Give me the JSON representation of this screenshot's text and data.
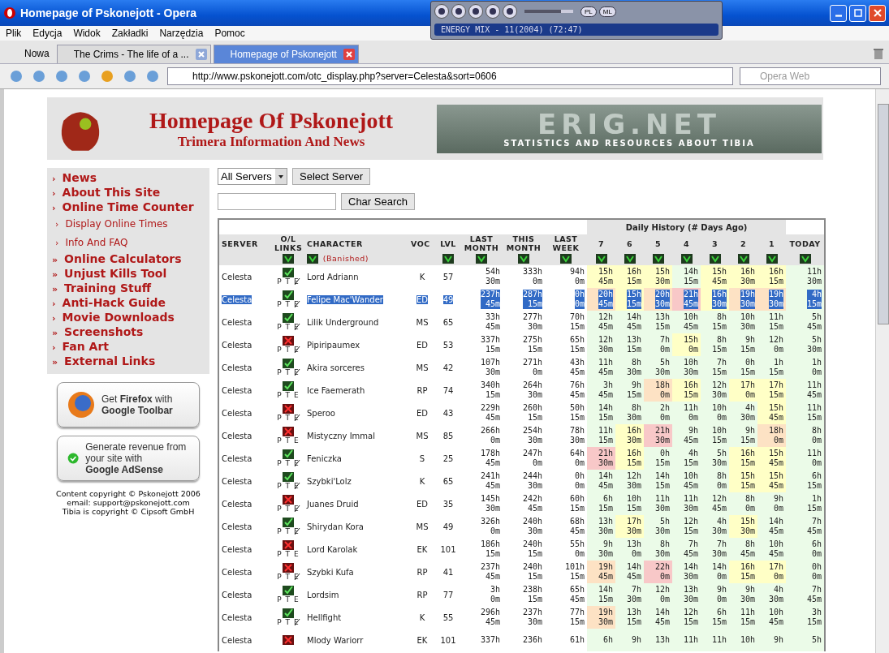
{
  "window": {
    "title": "Homepage of Pskonejott - Opera"
  },
  "player": {
    "track": "ENERGY MIX - 11(2004) (72:47)",
    "buttons": [
      "PL",
      "ML"
    ],
    "level": 0.75
  },
  "menu": [
    "Plik",
    "Edycja",
    "Widok",
    "Zakładki",
    "Narzędzia",
    "Pomoc"
  ],
  "new_tab": "Nowa",
  "tabs": [
    {
      "label": "The Crims - The life of a ...",
      "selected": false
    },
    {
      "label": "Homepage of Pskonejott",
      "selected": true
    }
  ],
  "address": "http://www.pskonejott.com/otc_display.php?server=Celesta&sort=0606",
  "search": {
    "placeholder": "Opera Web"
  },
  "header": {
    "title": "Homepage Of Pskonejott",
    "subtitle": "Trimera Information And News",
    "banner_logo": "ERIG.NET",
    "banner_caption": "STATISTICS AND RESOURCES ABOUT TIBIA"
  },
  "sidebar": [
    {
      "marker": "›",
      "label": "News",
      "kind": "main"
    },
    {
      "marker": "›",
      "label": "About This Site",
      "kind": "main"
    },
    {
      "marker": "›",
      "label": "Online Time Counter",
      "kind": "main"
    },
    {
      "marker": "›",
      "label": "Display Online Times",
      "kind": "sub"
    },
    {
      "marker": "›",
      "label": "Info And FAQ",
      "kind": "sub"
    },
    {
      "marker": "»",
      "label": "Online Calculators",
      "kind": "main"
    },
    {
      "marker": "»",
      "label": "Unjust Kills Tool",
      "kind": "main"
    },
    {
      "marker": "»",
      "label": "Training Stuff",
      "kind": "main"
    },
    {
      "marker": "›",
      "label": "Anti-Hack Guide",
      "kind": "main"
    },
    {
      "marker": "›",
      "label": "Movie Downloads",
      "kind": "main"
    },
    {
      "marker": "»",
      "label": "Screenshots",
      "kind": "main"
    },
    {
      "marker": "›",
      "label": "Fan Art",
      "kind": "main"
    },
    {
      "marker": "»",
      "label": "External Links",
      "kind": "main"
    }
  ],
  "ads": [
    {
      "kind": "firefox",
      "text": "Get **Firefox** with",
      "brand": "Google Toolbar"
    },
    {
      "kind": "adsense",
      "text": "Generate revenue from your site with",
      "brand": "**Google** AdSense"
    }
  ],
  "copyright": [
    "Content copyright © Pskonejott 2006",
    "email: support@pskonejott.com",
    "Tibia is copyright © Cipsoft GmbH"
  ],
  "server_select": {
    "value": "All Servers",
    "button": "Select Server"
  },
  "char_search": {
    "button": "Char Search"
  },
  "table": {
    "group_heading": "Daily History (# Days Ago)",
    "banished_label": "(Banished)",
    "columns": [
      {
        "label": "SERVER",
        "sortable": false
      },
      {
        "label": "O/L LINKS",
        "sortable": true
      },
      {
        "label": "CHARACTER",
        "sortable": true
      },
      {
        "label": "VOC",
        "sortable": false
      },
      {
        "label": "LVL",
        "sortable": true
      },
      {
        "label": "LAST MONTH",
        "sortable": true
      },
      {
        "label": "THIS MONTH",
        "sortable": true
      },
      {
        "label": "LAST WEEK",
        "sortable": true
      },
      {
        "label": "7",
        "sortable": true
      },
      {
        "label": "6",
        "sortable": true
      },
      {
        "label": "5",
        "sortable": true
      },
      {
        "label": "4",
        "sortable": true
      },
      {
        "label": "3",
        "sortable": true
      },
      {
        "label": "2",
        "sortable": true
      },
      {
        "label": "1",
        "sortable": true
      },
      {
        "label": "TODAY",
        "sortable": true
      }
    ],
    "rows": [
      {
        "server": "Celesta",
        "online": true,
        "links": "P T E",
        "e_crossed": true,
        "character": "Lord Adriann",
        "voc": "K",
        "lvl": "57",
        "selected": false,
        "totals": [
          {
            "h": "54h",
            "m": "30m"
          },
          {
            "h": "333h",
            "m": "0m"
          },
          {
            "h": "94h",
            "m": "0m"
          }
        ],
        "history": [
          {
            "h": "15h",
            "m": "45m",
            "color": "#ffffc6"
          },
          {
            "h": "16h",
            "m": "15m",
            "color": "#ffffc6"
          },
          {
            "h": "15h",
            "m": "30m",
            "color": "#ffffc6"
          },
          {
            "h": "14h",
            "m": "15m",
            "color": "#ebfbe8"
          },
          {
            "h": "15h",
            "m": "45m",
            "color": "#ffffc6"
          },
          {
            "h": "16h",
            "m": "30m",
            "color": "#ffffc6"
          },
          {
            "h": "16h",
            "m": "15m",
            "color": "#ffffc6"
          }
        ],
        "today": {
          "h": "11h",
          "m": "30m"
        }
      },
      {
        "server": "Celesta",
        "online": true,
        "links": "P T E",
        "e_crossed": true,
        "character": "Felipe Mac'Wander",
        "voc": "ED",
        "lvl": "49",
        "selected": true,
        "totals": [
          {
            "h": "237h",
            "m": "45m"
          },
          {
            "h": "287h",
            "m": "15m"
          },
          {
            "h": "0h",
            "m": "0m"
          }
        ],
        "history": [
          {
            "h": "20h",
            "m": "45m",
            "color": "#fde2c4"
          },
          {
            "h": "15h",
            "m": "15m",
            "color": "#ffffc6"
          },
          {
            "h": "20h",
            "m": "30m",
            "color": "#fde2c4"
          },
          {
            "h": "21h",
            "m": "45m",
            "color": "#f8c8c8"
          },
          {
            "h": "16h",
            "m": "30m",
            "color": "#ffffc6"
          },
          {
            "h": "19h",
            "m": "30m",
            "color": "#fde2c4"
          },
          {
            "h": "19h",
            "m": "30m",
            "color": "#fde2c4"
          }
        ],
        "today": {
          "h": "4h",
          "m": "15m"
        }
      },
      {
        "server": "Celesta",
        "online": true,
        "links": "P T E",
        "e_crossed": true,
        "character": "Lilik Underground",
        "voc": "MS",
        "lvl": "65",
        "selected": false,
        "totals": [
          {
            "h": "33h",
            "m": "45m"
          },
          {
            "h": "277h",
            "m": "30m"
          },
          {
            "h": "70h",
            "m": "15m"
          }
        ],
        "history": [
          {
            "h": "12h",
            "m": "45m",
            "color": "#ebfbe8"
          },
          {
            "h": "14h",
            "m": "45m",
            "color": "#ebfbe8"
          },
          {
            "h": "13h",
            "m": "15m",
            "color": "#ebfbe8"
          },
          {
            "h": "10h",
            "m": "45m",
            "color": "#ebfbe8"
          },
          {
            "h": "8h",
            "m": "15m",
            "color": "#ebfbe8"
          },
          {
            "h": "10h",
            "m": "30m",
            "color": "#ebfbe8"
          },
          {
            "h": "11h",
            "m": "15m",
            "color": "#ebfbe8"
          }
        ],
        "today": {
          "h": "5h",
          "m": "45m"
        }
      },
      {
        "server": "Celesta",
        "online": false,
        "links": "P T E",
        "e_crossed": true,
        "character": "Pipiripaumex",
        "voc": "ED",
        "lvl": "53",
        "selected": false,
        "totals": [
          {
            "h": "337h",
            "m": "15m"
          },
          {
            "h": "275h",
            "m": "15m"
          },
          {
            "h": "65h",
            "m": "15m"
          }
        ],
        "history": [
          {
            "h": "12h",
            "m": "30m",
            "color": "#ebfbe8"
          },
          {
            "h": "13h",
            "m": "15m",
            "color": "#ebfbe8"
          },
          {
            "h": "7h",
            "m": "0m",
            "color": "#ebfbe8"
          },
          {
            "h": "15h",
            "m": "0m",
            "color": "#ffffc6"
          },
          {
            "h": "8h",
            "m": "15m",
            "color": "#ebfbe8"
          },
          {
            "h": "9h",
            "m": "15m",
            "color": "#ebfbe8"
          },
          {
            "h": "12h",
            "m": "0m",
            "color": "#ebfbe8"
          }
        ],
        "today": {
          "h": "5h",
          "m": "30m"
        }
      },
      {
        "server": "Celesta",
        "online": true,
        "links": "P T E",
        "e_crossed": true,
        "character": "Akira sorceres",
        "voc": "MS",
        "lvl": "42",
        "selected": false,
        "totals": [
          {
            "h": "107h",
            "m": "30m"
          },
          {
            "h": "271h",
            "m": "0m"
          },
          {
            "h": "43h",
            "m": "45m"
          }
        ],
        "history": [
          {
            "h": "11h",
            "m": "45m",
            "color": "#ebfbe8"
          },
          {
            "h": "8h",
            "m": "30m",
            "color": "#ebfbe8"
          },
          {
            "h": "5h",
            "m": "30m",
            "color": "#ebfbe8"
          },
          {
            "h": "10h",
            "m": "30m",
            "color": "#ebfbe8"
          },
          {
            "h": "7h",
            "m": "15m",
            "color": "#ebfbe8"
          },
          {
            "h": "0h",
            "m": "15m",
            "color": "#ebfbe8"
          },
          {
            "h": "1h",
            "m": "15m",
            "color": "#ebfbe8"
          }
        ],
        "today": {
          "h": "1h",
          "m": "0m"
        }
      },
      {
        "server": "Celesta",
        "online": true,
        "links": "P T E",
        "e_crossed": false,
        "character": "Ice Faemerath",
        "voc": "RP",
        "lvl": "74",
        "selected": false,
        "totals": [
          {
            "h": "340h",
            "m": "15m"
          },
          {
            "h": "264h",
            "m": "30m"
          },
          {
            "h": "76h",
            "m": "45m"
          }
        ],
        "history": [
          {
            "h": "3h",
            "m": "45m",
            "color": "#ebfbe8"
          },
          {
            "h": "9h",
            "m": "15m",
            "color": "#ebfbe8"
          },
          {
            "h": "18h",
            "m": "0m",
            "color": "#fde2c4"
          },
          {
            "h": "16h",
            "m": "15m",
            "color": "#ffffc6"
          },
          {
            "h": "12h",
            "m": "30m",
            "color": "#ebfbe8"
          },
          {
            "h": "17h",
            "m": "0m",
            "color": "#ffffc6"
          },
          {
            "h": "17h",
            "m": "15m",
            "color": "#ffffc6"
          }
        ],
        "today": {
          "h": "11h",
          "m": "45m"
        }
      },
      {
        "server": "Celesta",
        "online": false,
        "links": "P T E",
        "e_crossed": true,
        "character": "Speroo",
        "voc": "ED",
        "lvl": "43",
        "selected": false,
        "totals": [
          {
            "h": "229h",
            "m": "45m"
          },
          {
            "h": "260h",
            "m": "15m"
          },
          {
            "h": "50h",
            "m": "15m"
          }
        ],
        "history": [
          {
            "h": "14h",
            "m": "15m",
            "color": "#ebfbe8"
          },
          {
            "h": "8h",
            "m": "30m",
            "color": "#ebfbe8"
          },
          {
            "h": "2h",
            "m": "0m",
            "color": "#ebfbe8"
          },
          {
            "h": "11h",
            "m": "0m",
            "color": "#ebfbe8"
          },
          {
            "h": "10h",
            "m": "0m",
            "color": "#ebfbe8"
          },
          {
            "h": "4h",
            "m": "30m",
            "color": "#ebfbe8"
          },
          {
            "h": "15h",
            "m": "45m",
            "color": "#ffffc6"
          }
        ],
        "today": {
          "h": "11h",
          "m": "15m"
        }
      },
      {
        "server": "Celesta",
        "online": false,
        "links": "P T E",
        "e_crossed": false,
        "character": "Mistyczny Immal",
        "voc": "MS",
        "lvl": "85",
        "selected": false,
        "totals": [
          {
            "h": "266h",
            "m": "0m"
          },
          {
            "h": "254h",
            "m": "30m"
          },
          {
            "h": "78h",
            "m": "30m"
          }
        ],
        "history": [
          {
            "h": "11h",
            "m": "15m",
            "color": "#ebfbe8"
          },
          {
            "h": "16h",
            "m": "30m",
            "color": "#ffffc6"
          },
          {
            "h": "21h",
            "m": "30m",
            "color": "#f8c8c8"
          },
          {
            "h": "9h",
            "m": "45m",
            "color": "#ebfbe8"
          },
          {
            "h": "10h",
            "m": "15m",
            "color": "#ebfbe8"
          },
          {
            "h": "9h",
            "m": "15m",
            "color": "#ebfbe8"
          },
          {
            "h": "18h",
            "m": "0m",
            "color": "#fde2c4"
          }
        ],
        "today": {
          "h": "8h",
          "m": "0m"
        }
      },
      {
        "server": "Celesta",
        "online": true,
        "links": "P T E",
        "e_crossed": true,
        "character": "Feniczka",
        "voc": "S",
        "lvl": "25",
        "selected": false,
        "totals": [
          {
            "h": "178h",
            "m": "45m"
          },
          {
            "h": "247h",
            "m": "0m"
          },
          {
            "h": "64h",
            "m": "0m"
          }
        ],
        "history": [
          {
            "h": "21h",
            "m": "30m",
            "color": "#f8c8c8"
          },
          {
            "h": "16h",
            "m": "15m",
            "color": "#ffffc6"
          },
          {
            "h": "0h",
            "m": "15m",
            "color": "#ebfbe8"
          },
          {
            "h": "4h",
            "m": "15m",
            "color": "#ebfbe8"
          },
          {
            "h": "5h",
            "m": "30m",
            "color": "#ebfbe8"
          },
          {
            "h": "16h",
            "m": "15m",
            "color": "#ffffc6"
          },
          {
            "h": "15h",
            "m": "45m",
            "color": "#ffffc6"
          }
        ],
        "today": {
          "h": "11h",
          "m": "0m"
        }
      },
      {
        "server": "Celesta",
        "online": true,
        "links": "P T E",
        "e_crossed": true,
        "character": "Szybki'Lolz",
        "voc": "K",
        "lvl": "65",
        "selected": false,
        "totals": [
          {
            "h": "241h",
            "m": "45m"
          },
          {
            "h": "244h",
            "m": "30m"
          },
          {
            "h": "0h",
            "m": "0m"
          }
        ],
        "history": [
          {
            "h": "14h",
            "m": "45m",
            "color": "#ebfbe8"
          },
          {
            "h": "12h",
            "m": "30m",
            "color": "#ebfbe8"
          },
          {
            "h": "14h",
            "m": "15m",
            "color": "#ebfbe8"
          },
          {
            "h": "10h",
            "m": "45m",
            "color": "#ebfbe8"
          },
          {
            "h": "8h",
            "m": "0m",
            "color": "#ebfbe8"
          },
          {
            "h": "15h",
            "m": "15m",
            "color": "#ffffc6"
          },
          {
            "h": "15h",
            "m": "45m",
            "color": "#ffffc6"
          }
        ],
        "today": {
          "h": "6h",
          "m": "15m"
        }
      },
      {
        "server": "Celesta",
        "online": false,
        "links": "P T E",
        "e_crossed": true,
        "character": "Juanes Druid",
        "voc": "ED",
        "lvl": "35",
        "selected": false,
        "totals": [
          {
            "h": "145h",
            "m": "30m"
          },
          {
            "h": "242h",
            "m": "45m"
          },
          {
            "h": "60h",
            "m": "15m"
          }
        ],
        "history": [
          {
            "h": "6h",
            "m": "15m",
            "color": "#ebfbe8"
          },
          {
            "h": "10h",
            "m": "15m",
            "color": "#ebfbe8"
          },
          {
            "h": "11h",
            "m": "30m",
            "color": "#ebfbe8"
          },
          {
            "h": "11h",
            "m": "30m",
            "color": "#ebfbe8"
          },
          {
            "h": "12h",
            "m": "45m",
            "color": "#ebfbe8"
          },
          {
            "h": "8h",
            "m": "0m",
            "color": "#ebfbe8"
          },
          {
            "h": "9h",
            "m": "0m",
            "color": "#ebfbe8"
          }
        ],
        "today": {
          "h": "1h",
          "m": "15m"
        }
      },
      {
        "server": "Celesta",
        "online": true,
        "links": "P T E",
        "e_crossed": true,
        "character": "Shirydan Kora",
        "voc": "MS",
        "lvl": "49",
        "selected": false,
        "totals": [
          {
            "h": "326h",
            "m": "0m"
          },
          {
            "h": "240h",
            "m": "30m"
          },
          {
            "h": "68h",
            "m": "45m"
          }
        ],
        "history": [
          {
            "h": "13h",
            "m": "30m",
            "color": "#ebfbe8"
          },
          {
            "h": "17h",
            "m": "30m",
            "color": "#ffffc6"
          },
          {
            "h": "5h",
            "m": "30m",
            "color": "#ebfbe8"
          },
          {
            "h": "12h",
            "m": "15m",
            "color": "#ebfbe8"
          },
          {
            "h": "4h",
            "m": "30m",
            "color": "#ebfbe8"
          },
          {
            "h": "15h",
            "m": "30m",
            "color": "#ffffc6"
          },
          {
            "h": "14h",
            "m": "45m",
            "color": "#ebfbe8"
          }
        ],
        "today": {
          "h": "7h",
          "m": "45m"
        }
      },
      {
        "server": "Celesta",
        "online": false,
        "links": "P T E",
        "e_crossed": false,
        "character": "Lord Karolak",
        "voc": "EK",
        "lvl": "101",
        "selected": false,
        "totals": [
          {
            "h": "186h",
            "m": "15m"
          },
          {
            "h": "240h",
            "m": "15m"
          },
          {
            "h": "55h",
            "m": "0m"
          }
        ],
        "history": [
          {
            "h": "9h",
            "m": "30m",
            "color": "#ebfbe8"
          },
          {
            "h": "13h",
            "m": "0m",
            "color": "#ebfbe8"
          },
          {
            "h": "8h",
            "m": "30m",
            "color": "#ebfbe8"
          },
          {
            "h": "7h",
            "m": "45m",
            "color": "#ebfbe8"
          },
          {
            "h": "7h",
            "m": "30m",
            "color": "#ebfbe8"
          },
          {
            "h": "8h",
            "m": "45m",
            "color": "#ebfbe8"
          },
          {
            "h": "10h",
            "m": "45m",
            "color": "#ebfbe8"
          }
        ],
        "today": {
          "h": "6h",
          "m": "0m"
        }
      },
      {
        "server": "Celesta",
        "online": false,
        "links": "P T E",
        "e_crossed": true,
        "character": "Szybki Kufa",
        "voc": "RP",
        "lvl": "41",
        "selected": false,
        "totals": [
          {
            "h": "237h",
            "m": "45m"
          },
          {
            "h": "240h",
            "m": "15m"
          },
          {
            "h": "101h",
            "m": "15m"
          }
        ],
        "history": [
          {
            "h": "19h",
            "m": "45m",
            "color": "#fde2c4"
          },
          {
            "h": "14h",
            "m": "45m",
            "color": "#ebfbe8"
          },
          {
            "h": "22h",
            "m": "0m",
            "color": "#f8c8c8"
          },
          {
            "h": "14h",
            "m": "30m",
            "color": "#ebfbe8"
          },
          {
            "h": "14h",
            "m": "0m",
            "color": "#ebfbe8"
          },
          {
            "h": "16h",
            "m": "15m",
            "color": "#ffffc6"
          },
          {
            "h": "17h",
            "m": "0m",
            "color": "#ffffc6"
          }
        ],
        "today": {
          "h": "0h",
          "m": "0m"
        }
      },
      {
        "server": "Celesta",
        "online": true,
        "links": "P T E",
        "e_crossed": false,
        "character": "Lordsim",
        "voc": "RP",
        "lvl": "77",
        "selected": false,
        "totals": [
          {
            "h": "3h",
            "m": "0m"
          },
          {
            "h": "238h",
            "m": "15m"
          },
          {
            "h": "65h",
            "m": "45m"
          }
        ],
        "history": [
          {
            "h": "14h",
            "m": "15m",
            "color": "#ebfbe8"
          },
          {
            "h": "7h",
            "m": "30m",
            "color": "#ebfbe8"
          },
          {
            "h": "12h",
            "m": "0m",
            "color": "#ebfbe8"
          },
          {
            "h": "13h",
            "m": "30m",
            "color": "#ebfbe8"
          },
          {
            "h": "9h",
            "m": "0m",
            "color": "#ebfbe8"
          },
          {
            "h": "9h",
            "m": "30m",
            "color": "#ebfbe8"
          },
          {
            "h": "4h",
            "m": "30m",
            "color": "#ebfbe8"
          }
        ],
        "today": {
          "h": "7h",
          "m": "45m"
        }
      },
      {
        "server": "Celesta",
        "online": true,
        "links": "P T E",
        "e_crossed": true,
        "character": "Hellfight",
        "voc": "K",
        "lvl": "55",
        "selected": false,
        "totals": [
          {
            "h": "296h",
            "m": "45m"
          },
          {
            "h": "237h",
            "m": "30m"
          },
          {
            "h": "77h",
            "m": "15m"
          }
        ],
        "history": [
          {
            "h": "19h",
            "m": "30m",
            "color": "#fde2c4"
          },
          {
            "h": "13h",
            "m": "15m",
            "color": "#ebfbe8"
          },
          {
            "h": "14h",
            "m": "45m",
            "color": "#ebfbe8"
          },
          {
            "h": "12h",
            "m": "15m",
            "color": "#ebfbe8"
          },
          {
            "h": "6h",
            "m": "15m",
            "color": "#ebfbe8"
          },
          {
            "h": "11h",
            "m": "15m",
            "color": "#ebfbe8"
          },
          {
            "h": "10h",
            "m": "45m",
            "color": "#ebfbe8"
          }
        ],
        "today": {
          "h": "3h",
          "m": "15m"
        }
      },
      {
        "server": "Celesta",
        "online": false,
        "character": "Mlody Wariorr",
        "voc": "EK",
        "lvl": "101",
        "selected": false,
        "totals": [
          {
            "h": "337h"
          },
          {
            "h": "236h"
          },
          {
            "h": "61h"
          }
        ],
        "history": [
          {
            "h": "6h",
            "color": "#ebfbe8"
          },
          {
            "h": "9h",
            "color": "#ebfbe8"
          },
          {
            "h": "13h",
            "color": "#ebfbe8"
          },
          {
            "h": "11h",
            "color": "#ebfbe8"
          },
          {
            "h": "11h",
            "color": "#ebfbe8"
          },
          {
            "h": "10h",
            "color": "#ebfbe8"
          },
          {
            "h": "9h",
            "color": "#ebfbe8"
          }
        ],
        "today": {
          "h": "5h"
        }
      }
    ]
  }
}
